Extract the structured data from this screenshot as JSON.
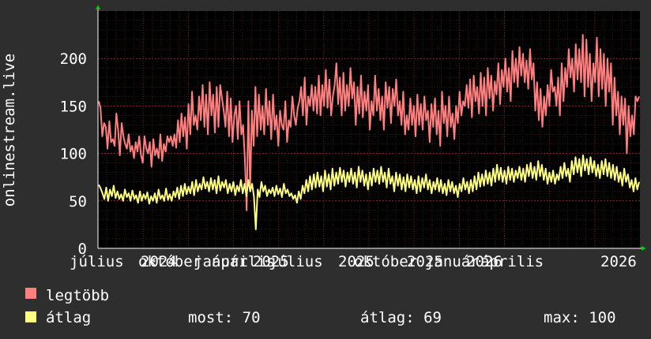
{
  "chart_data": {
    "type": "line",
    "ylabel": "onlinestream.live",
    "ylim": [
      0,
      250
    ],
    "y_ticks": [
      "0",
      "50",
      "100",
      "150",
      "200"
    ],
    "x_ticks": [
      "július",
      "október",
      "2024",
      "január",
      "április",
      "2025",
      "július",
      "október",
      "2025",
      "január",
      "április",
      "2026"
    ],
    "x_tick_labels": [
      "július",
      "október",
      "2024",
      "január",
      "április",
      "2025",
      "július",
      "2025",
      "október",
      "2025",
      "január",
      "2026",
      "április",
      "2026"
    ],
    "grid": true,
    "background": "#000000",
    "grid_color": "#7a2020",
    "series": [
      {
        "name": "legtöbb",
        "color": "#ff7f7f",
        "values": [
          155,
          148,
          118,
          132,
          128,
          105,
          134,
          112,
          115,
          108,
          142,
          125,
          98,
          132,
          118,
          110,
          105,
          120,
          102,
          108,
          95,
          112,
          102,
          118,
          98,
          90,
          118,
          105,
          100,
          112,
          86,
          115,
          98,
          105,
          95,
          120,
          92,
          110,
          102,
          118,
          112,
          118,
          108,
          120,
          106,
          135,
          112,
          142,
          118,
          138,
          105,
          152,
          120,
          165,
          130,
          140,
          125,
          160,
          135,
          172,
          128,
          162,
          120,
          175,
          140,
          162,
          122,
          170,
          128,
          172,
          158,
          145,
          128,
          165,
          118,
          158,
          112,
          140,
          150,
          115,
          155,
          120,
          130,
          95,
          40,
          155,
          60,
          145,
          108,
          170,
          118,
          162,
          125,
          150,
          120,
          168,
          130,
          155,
          115,
          162,
          125,
          140,
          108,
          145,
          130,
          125,
          155,
          112,
          135,
          128,
          160,
          140,
          130,
          148,
          155,
          170,
          140,
          180,
          130,
          160,
          150,
          172,
          145,
          170,
          142,
          182,
          140,
          172,
          150,
          188,
          148,
          178,
          140,
          160,
          172,
          195,
          152,
          180,
          140,
          185,
          145,
          172,
          150,
          190,
          158,
          175,
          130,
          170,
          142,
          182,
          138,
          165,
          145,
          172,
          125,
          155,
          140,
          182,
          145,
          168,
          135,
          160,
          125,
          175,
          148,
          170,
          132,
          168,
          150,
          178,
          140,
          155,
          130,
          165,
          120,
          140,
          125,
          158,
          130,
          150,
          118,
          162,
          130,
          152,
          125,
          160,
          135,
          145,
          112,
          152,
          128,
          158,
          120,
          145,
          108,
          165,
          132,
          150,
          118,
          160,
          128,
          142,
          115,
          150,
          132,
          165,
          140,
          155,
          150,
          172,
          148,
          178,
          138,
          182,
          155,
          170,
          142,
          185,
          150,
          180,
          140,
          190,
          158,
          182,
          145,
          176,
          162,
          195,
          152,
          188,
          170,
          200,
          165,
          190,
          155,
          208,
          175,
          200,
          170,
          212,
          182,
          205,
          175,
          198,
          168,
          210,
          178,
          195,
          145,
          175,
          135,
          168,
          128,
          160,
          140,
          172,
          150,
          188,
          165,
          170,
          150,
          180,
          140,
          195,
          155,
          190,
          170,
          210,
          180,
          200,
          165,
          215,
          178,
          210,
          175,
          225,
          160,
          220,
          170,
          205,
          155,
          195,
          175,
          222,
          160,
          210,
          168,
          205,
          150,
          200,
          165,
          195,
          130,
          180,
          140,
          165,
          120,
          160,
          130,
          158,
          100,
          150,
          118,
          140,
          120,
          160,
          155,
          160
        ]
      },
      {
        "name": "átlag",
        "color": "#ffff80",
        "values": [
          67,
          63,
          58,
          52,
          64,
          50,
          62,
          55,
          66,
          53,
          60,
          52,
          57,
          50,
          62,
          54,
          58,
          50,
          61,
          52,
          56,
          48,
          60,
          50,
          57,
          52,
          59,
          47,
          55,
          50,
          58,
          48,
          62,
          52,
          56,
          50,
          63,
          51,
          57,
          50,
          60,
          54,
          64,
          52,
          66,
          55,
          68,
          57,
          65,
          58,
          70,
          56,
          72,
          60,
          68,
          62,
          75,
          63,
          70,
          60,
          74,
          62,
          72,
          58,
          76,
          61,
          70,
          64,
          72,
          58,
          68,
          60,
          70,
          56,
          66,
          60,
          72,
          58,
          68,
          55,
          72,
          60,
          68,
          55,
          20,
          62,
          54,
          70,
          60,
          66,
          55,
          62,
          58,
          64,
          55,
          66,
          57,
          63,
          54,
          68,
          58,
          62,
          55,
          58,
          52,
          56,
          48,
          60,
          52,
          66,
          58,
          72,
          60,
          76,
          62,
          78,
          64,
          80,
          65,
          76,
          60,
          82,
          65,
          78,
          62,
          84,
          66,
          80,
          68,
          85,
          70,
          82,
          65,
          80,
          70,
          84,
          68,
          80,
          64,
          86,
          70,
          82,
          66,
          78,
          62,
          80,
          66,
          84,
          70,
          82,
          68,
          86,
          70,
          80,
          64,
          84,
          68,
          76,
          60,
          80,
          66,
          78,
          62,
          75,
          60,
          78,
          64,
          76,
          62,
          72,
          58,
          76,
          60,
          74,
          64,
          78,
          62,
          72,
          58,
          70,
          62,
          74,
          60,
          72,
          58,
          68,
          56,
          72,
          60,
          70,
          58,
          66,
          54,
          68,
          60,
          74,
          62,
          70,
          58,
          72,
          60,
          76,
          62,
          80,
          65,
          78,
          66,
          82,
          68,
          80,
          66,
          84,
          70,
          88,
          72,
          85,
          70,
          82,
          68,
          86,
          72,
          84,
          70,
          82,
          74,
          86,
          72,
          84,
          70,
          88,
          76,
          90,
          74,
          86,
          72,
          92,
          76,
          88,
          72,
          84,
          68,
          80,
          70,
          82,
          68,
          78,
          72,
          86,
          74,
          90,
          76,
          84,
          70,
          92,
          78,
          96,
          80,
          94,
          76,
          98,
          82,
          94,
          78,
          96,
          80,
          92,
          76,
          88,
          74,
          92,
          78,
          94,
          76,
          90,
          74,
          88,
          72,
          86,
          70,
          80,
          66,
          84,
          70,
          78,
          64,
          72,
          60,
          74,
          62,
          70
        ]
      }
    ]
  },
  "legend": [
    {
      "label": "legtöbb",
      "color": "#ff7f7f"
    },
    {
      "label": "átlag",
      "color": "#ffff80"
    }
  ],
  "stats": {
    "now": "most: 70",
    "avg": "átlag: 69",
    "max": "max: 100"
  }
}
